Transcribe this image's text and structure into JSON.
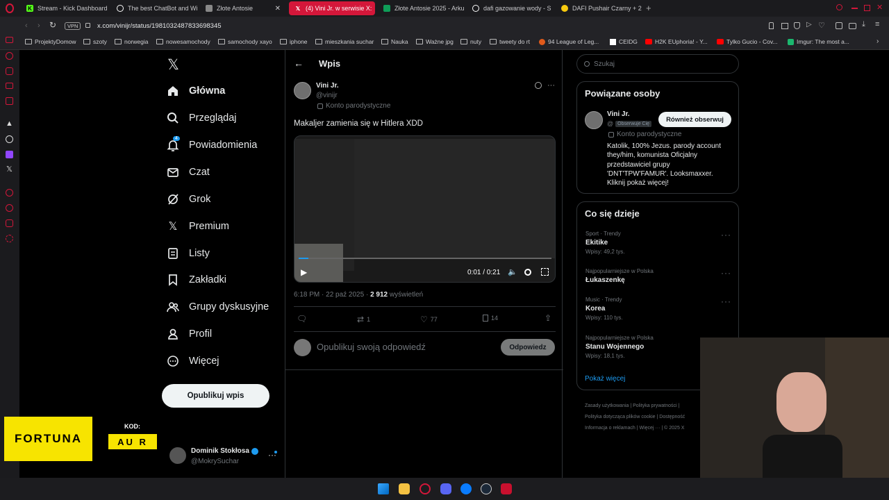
{
  "browser": {
    "tabs": [
      {
        "label": "Stream - Kick Dashboard",
        "fav": "K",
        "color": "#53fc18"
      },
      {
        "label": "The best ChatBot and Wi",
        "fav": "",
        "color": "#fff"
      },
      {
        "label": "Złote Antosie",
        "fav": "",
        "color": "#aaa"
      },
      {
        "label": "(4) Vini Jr. w serwisie X:",
        "fav": "X",
        "color": "#fff"
      },
      {
        "label": "Złote Antosie 2025 - Arku",
        "fav": "",
        "color": "#0f9d58"
      },
      {
        "label": "dafi gazowanie wody - S",
        "fav": "G",
        "color": "#fff"
      },
      {
        "label": "DAFI Pushair Czarny + 2",
        "fav": "",
        "color": "#f6c90e"
      }
    ],
    "vpn": "VPN",
    "url": "x.com/vinijr/status/1981032487833698345",
    "bookmarks": [
      "ProjektyDomow",
      "szoty",
      "norwegia",
      "nowesamochody",
      "samochody xayo",
      "iphone",
      "mieszkania suchar",
      "Nauka",
      "Ważne jpg",
      "nuty",
      "tweety do rt",
      "94 League of Leg...",
      "CEIDG",
      "H2K EUphoria! - Y...",
      "Tylko Gucio - Cov...",
      "Imgur: The most a..."
    ]
  },
  "nav": {
    "items": [
      "Główna",
      "Przeglądaj",
      "Powiadomienia",
      "Czat",
      "Grok",
      "Premium",
      "Listy",
      "Zakładki",
      "Grupy dyskusyjne",
      "Profil",
      "Więcej"
    ],
    "notif_badge": "4",
    "post_button": "Opublikuj wpis",
    "account_name": "Dominik Stokłosa",
    "account_handle": "@MokrySuchar"
  },
  "post": {
    "header_title": "Wpis",
    "author_name": "Vini Jr.",
    "author_handle": "@vinijr",
    "parody_label": "Konto parodystyczne",
    "text": "Makaljer zamienia się w Hitlera XDD",
    "video_time": "0:01 / 0:21",
    "timestamp": "6:18 PM · 22 paź 2025 · ",
    "views": "2 912",
    "views_label": " wyświetleń",
    "retweets": "1",
    "likes": "77",
    "bookmarks": "14",
    "reply_placeholder": "Opublikuj swoją odpowiedź",
    "reply_button": "Odpowiedz"
  },
  "right": {
    "search_placeholder": "Szukaj",
    "related_title": "Powiązane osoby",
    "related_name": "Vini Jr.",
    "related_handle": "@",
    "follows_you": "Obserwuje Cię",
    "follow_back": "Również obserwuj",
    "related_parody": "Konto parodystyczne",
    "related_bio": "Katolik, 100% Jezus. parody account they/him, komunista Oficjalny przedstawiciel grupy 'DNT'TPW'FAMUR'. Looksmaxxer. Kliknij pokaż więcej!",
    "trends_title": "Co się dzieje",
    "trends": [
      {
        "category": "Sport · Trendy",
        "name": "Ekitike",
        "count": "Wpisy: 49,2 tys."
      },
      {
        "category": "Najpopularniejsze w Polska",
        "name": "Łukaszenkę",
        "count": ""
      },
      {
        "category": "Music · Trendy",
        "name": "Korea",
        "count": "Wpisy: 110 tys."
      },
      {
        "category": "Najpopularniejsze w Polska",
        "name": "Stanu Wojennego",
        "count": "Wpisy: 18,1 tys."
      }
    ],
    "show_more": "Pokaż więcej",
    "footer": [
      "Zasady użytkowania",
      "Polityka prywatności",
      "Polityka dotycząca plików cookie",
      "Dostępność",
      "Informacja o reklamach",
      "Więcej ···",
      "© 2025 X"
    ]
  },
  "overlay": {
    "brand": "FORTUNA",
    "code_label": "KOD:",
    "code_value": "AU R"
  }
}
